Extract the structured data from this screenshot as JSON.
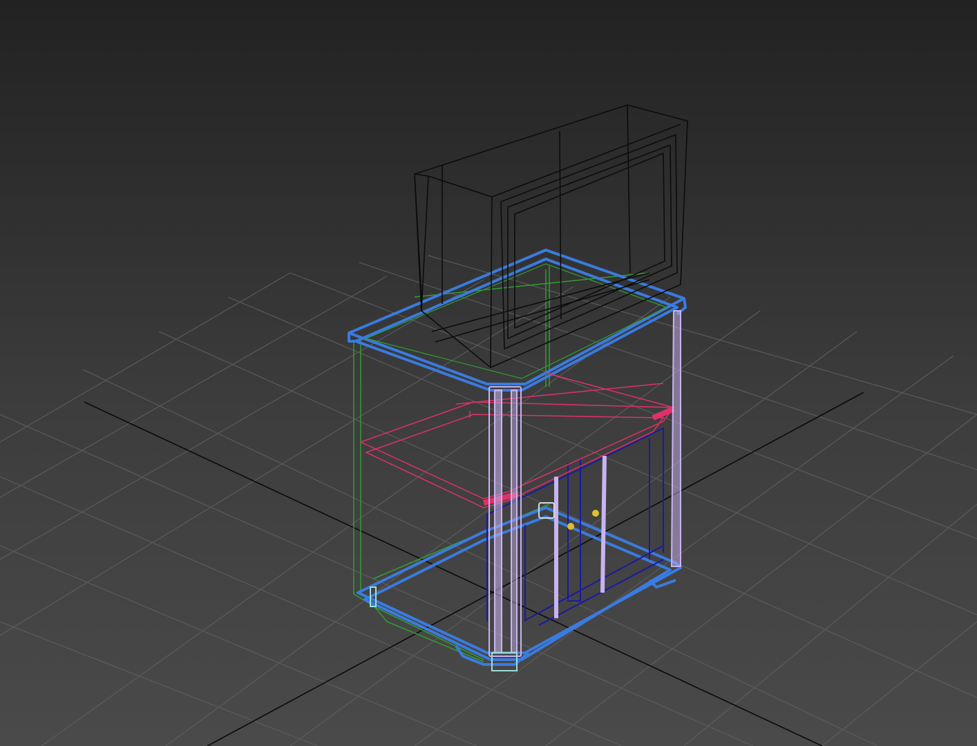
{
  "viewport": {
    "background_top": "#222222",
    "background_bottom": "#4a4a4a"
  },
  "scene": {
    "grid_color": "#5a5a5a",
    "axis_color": "#0a0a0a",
    "objects": [
      {
        "name": "tv-wireframe",
        "color": "#111111"
      },
      {
        "name": "nightstand-top",
        "color": "#3a7be0"
      },
      {
        "name": "nightstand-base",
        "color": "#3a7be0"
      },
      {
        "name": "drawer-frame",
        "color": "#e0306a"
      },
      {
        "name": "side-panel",
        "color": "#2fa02f"
      },
      {
        "name": "door-panel",
        "color": "#1a1aa0"
      },
      {
        "name": "legs",
        "color": "#c8b4f0"
      },
      {
        "name": "handles",
        "color": "#e0c030"
      }
    ]
  }
}
